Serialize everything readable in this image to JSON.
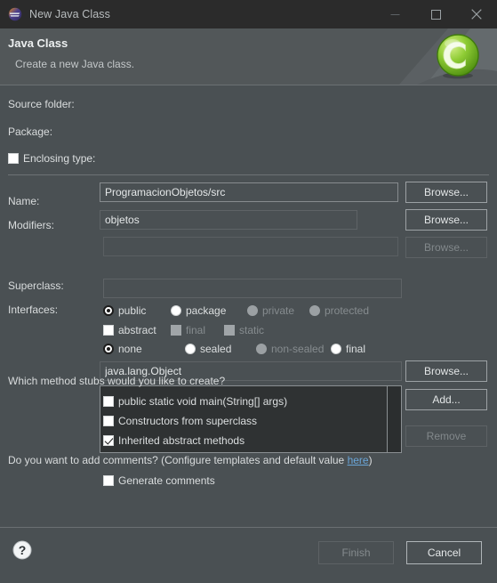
{
  "window": {
    "title": "New Java Class",
    "app_icon": "eclipse-icon",
    "minimize_label": "Minimize",
    "maximize_label": "Maximize",
    "close_label": "Close"
  },
  "header": {
    "title": "Java Class",
    "subtitle": "Create a new Java class.",
    "logo": "java-class-wizard-icon"
  },
  "form": {
    "source_folder": {
      "label": "Source folder:",
      "value": "ProgramacionObjetos/src",
      "button": "Browse...",
      "enabled": true
    },
    "package": {
      "label": "Package:",
      "value": "objetos",
      "button": "Browse...",
      "enabled": true
    },
    "enclosing_type": {
      "label": "Enclosing type:",
      "checked": false,
      "value": "",
      "button": "Browse...",
      "enabled": false
    },
    "name": {
      "label": "Name:",
      "value": ""
    },
    "modifiers": {
      "label": "Modifiers:",
      "access": [
        {
          "label": "public",
          "selected": true,
          "enabled": true,
          "mnemonic": "p"
        },
        {
          "label": "package",
          "selected": false,
          "enabled": true,
          "mnemonic": "c"
        },
        {
          "label": "private",
          "selected": false,
          "enabled": false,
          "mnemonic": ""
        },
        {
          "label": "protected",
          "selected": false,
          "enabled": false,
          "mnemonic": ""
        }
      ],
      "flags": [
        {
          "label": "abstract",
          "checked": false,
          "enabled": true
        },
        {
          "label": "final",
          "checked": false,
          "enabled": false
        },
        {
          "label": "static",
          "checked": false,
          "enabled": false
        }
      ],
      "sealed": [
        {
          "label": "none",
          "selected": true,
          "enabled": true
        },
        {
          "label": "sealed",
          "selected": false,
          "enabled": true
        },
        {
          "label": "non-sealed",
          "selected": false,
          "enabled": false
        },
        {
          "label": "final",
          "selected": false,
          "enabled": true
        }
      ]
    },
    "superclass": {
      "label": "Superclass:",
      "value": "java.lang.Object",
      "button": "Browse..."
    },
    "interfaces": {
      "label": "Interfaces:",
      "items": [],
      "add_button": "Add...",
      "remove_button": "Remove",
      "remove_enabled": false
    }
  },
  "stubs": {
    "question": "Which method stubs would you like to create?",
    "options": [
      {
        "label": "public static void main(String[] args)",
        "checked": false
      },
      {
        "label": "Constructors from superclass",
        "checked": false
      },
      {
        "label": "Inherited abstract methods",
        "checked": true
      }
    ]
  },
  "comments": {
    "question_pre": "Do you want to add comments? (Configure templates and default value ",
    "link": "here",
    "question_post": ")",
    "option": {
      "label": "Generate comments",
      "checked": false
    }
  },
  "footer": {
    "help": "help-icon",
    "finish": {
      "label": "Finish",
      "enabled": false
    },
    "cancel": {
      "label": "Cancel",
      "enabled": true
    }
  }
}
